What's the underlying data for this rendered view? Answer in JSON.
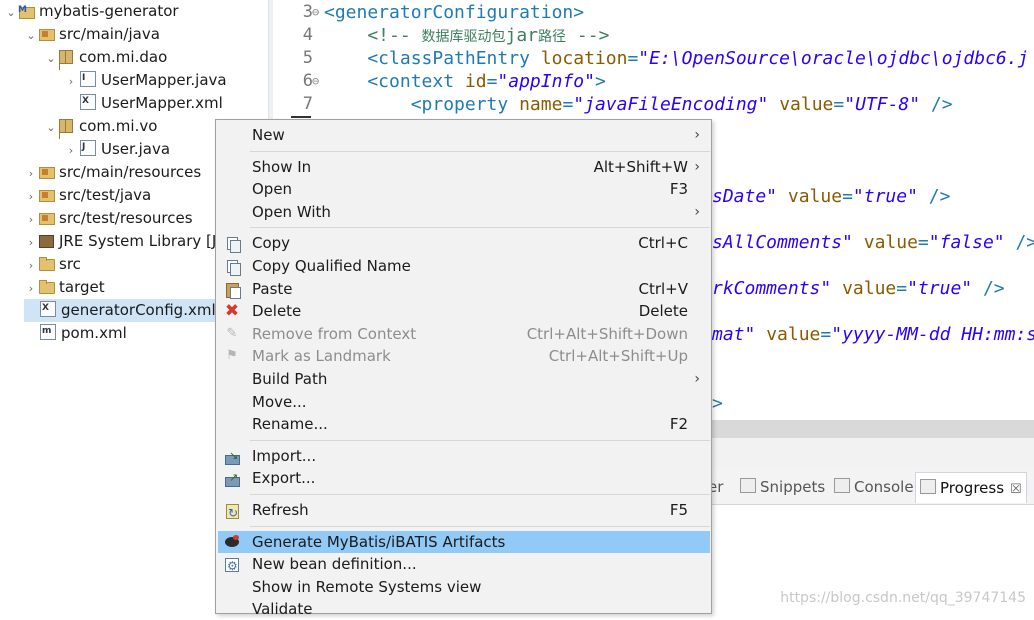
{
  "explorer": {
    "items": [
      {
        "label": "mybatis-generator",
        "twisty": "⌄",
        "icon": "project-icon"
      },
      {
        "label": "src/main/java",
        "twisty": "⌄",
        "icon": "source-folder-icon"
      },
      {
        "label": "com.mi.dao",
        "twisty": "⌄",
        "icon": "package-icon"
      },
      {
        "label": "UserMapper.java",
        "twisty": "›",
        "icon": "java-interface-icon"
      },
      {
        "label": "UserMapper.xml",
        "twisty": "",
        "icon": "xml-file-icon"
      },
      {
        "label": "com.mi.vo",
        "twisty": "⌄",
        "icon": "package-icon"
      },
      {
        "label": "User.java",
        "twisty": "›",
        "icon": "java-file-icon"
      },
      {
        "label": "src/main/resources",
        "twisty": "›",
        "icon": "source-folder-icon"
      },
      {
        "label": "src/test/java",
        "twisty": "›",
        "icon": "source-folder-icon"
      },
      {
        "label": "src/test/resources",
        "twisty": "›",
        "icon": "source-folder-icon"
      },
      {
        "label": "JRE System Library [J2",
        "twisty": "›",
        "icon": "library-icon"
      },
      {
        "label": "src",
        "twisty": "›",
        "icon": "folder-icon"
      },
      {
        "label": "target",
        "twisty": "›",
        "icon": "folder-icon"
      },
      {
        "label": "generatorConfig.xml",
        "twisty": "",
        "icon": "xml-file-icon"
      },
      {
        "label": "pom.xml",
        "twisty": "",
        "icon": "maven-pom-icon"
      }
    ]
  },
  "editor": {
    "lines": [
      {
        "num": "3",
        "fold": "⊖",
        "parts": [
          [
            "tag",
            "<generatorConfiguration>"
          ]
        ]
      },
      {
        "num": "4",
        "fold": "",
        "parts": [
          [
            "com",
            "    <!-- "
          ],
          [
            "cjkcom",
            "数据库驱动包"
          ],
          [
            "com",
            "jar"
          ],
          [
            "cjkcom",
            "路径"
          ],
          [
            "com",
            " -->"
          ]
        ]
      },
      {
        "num": "5",
        "fold": "",
        "parts": [
          [
            "tag",
            "    <classPathEntry "
          ],
          [
            "attr",
            "location"
          ],
          [
            "tag",
            "="
          ],
          [
            "val",
            "\"E:\\OpenSource\\oracle\\ojdbc\\ojdbc6.j"
          ]
        ]
      },
      {
        "num": "6",
        "fold": "⊖",
        "parts": [
          [
            "tag",
            "    <context "
          ],
          [
            "attr",
            "id"
          ],
          [
            "tag",
            "="
          ],
          [
            "val",
            "\"appInfo\""
          ],
          [
            "tag",
            ">"
          ]
        ]
      },
      {
        "num": "7",
        "fold": "",
        "parts": [
          [
            "tag",
            "        <property "
          ],
          [
            "attr",
            "name"
          ],
          [
            "tag",
            "="
          ],
          [
            "val",
            "\"javaFileEncoding\""
          ],
          [
            "tag",
            " "
          ],
          [
            "attr",
            "value"
          ],
          [
            "tag",
            "="
          ],
          [
            "val",
            "\"UTF-8\""
          ],
          [
            "tag",
            " />"
          ]
        ]
      }
    ],
    "partials": [
      [
        [
          "val",
          "sDate\""
        ],
        [
          "tag",
          " "
        ],
        [
          "attr",
          "value"
        ],
        [
          "tag",
          "="
        ],
        [
          "val",
          "\"true\""
        ],
        [
          "tag",
          " />"
        ]
      ],
      [
        [
          "val",
          "sAllComments\""
        ],
        [
          "tag",
          " "
        ],
        [
          "attr",
          "value"
        ],
        [
          "tag",
          "="
        ],
        [
          "val",
          "\"false\""
        ],
        [
          "tag",
          " />"
        ]
      ],
      [
        [
          "val",
          "rkComments\""
        ],
        [
          "tag",
          " "
        ],
        [
          "attr",
          "value"
        ],
        [
          "tag",
          "="
        ],
        [
          "val",
          "\"true\""
        ],
        [
          "tag",
          " />"
        ]
      ],
      [
        [
          "val",
          "mat\""
        ],
        [
          "tag",
          " "
        ],
        [
          "attr",
          "value"
        ],
        [
          "tag",
          "="
        ],
        [
          "val",
          "\"yyyy-MM-dd HH:mm:s"
        ]
      ],
      [
        [
          "tag",
          ">"
        ]
      ]
    ]
  },
  "views": {
    "tabs": [
      {
        "label": "er",
        "icon": ""
      },
      {
        "label": "Snippets",
        "icon": "snippets-icon"
      },
      {
        "label": "Console",
        "icon": "console-icon"
      },
      {
        "label": "Progress",
        "icon": "progress-icon",
        "close": "☒",
        "active": true
      }
    ],
    "watermark": "https://blog.csdn.net/qq_39747145"
  },
  "menu": {
    "items": [
      {
        "label": "New",
        "shortcut": "",
        "submenu": true,
        "icon": ""
      },
      {
        "sep": true
      },
      {
        "label": "Show In",
        "shortcut": "Alt+Shift+W",
        "submenu": true,
        "icon": ""
      },
      {
        "label": "Open",
        "shortcut": "F3",
        "submenu": false,
        "icon": ""
      },
      {
        "label": "Open With",
        "shortcut": "",
        "submenu": true,
        "icon": ""
      },
      {
        "sep": true
      },
      {
        "label": "Copy",
        "shortcut": "Ctrl+C",
        "submenu": false,
        "icon": "copy-icon"
      },
      {
        "label": "Copy Qualified Name",
        "shortcut": "",
        "submenu": false,
        "icon": "copy-icon"
      },
      {
        "label": "Paste",
        "shortcut": "Ctrl+V",
        "submenu": false,
        "icon": "paste-icon"
      },
      {
        "label": "Delete",
        "shortcut": "Delete",
        "submenu": false,
        "icon": "delete-icon"
      },
      {
        "label": "Remove from Context",
        "shortcut": "Ctrl+Alt+Shift+Down",
        "submenu": false,
        "icon": "remove-context-icon",
        "disabled": true
      },
      {
        "label": "Mark as Landmark",
        "shortcut": "Ctrl+Alt+Shift+Up",
        "submenu": false,
        "icon": "landmark-icon",
        "disabled": true
      },
      {
        "label": "Build Path",
        "shortcut": "",
        "submenu": true,
        "icon": ""
      },
      {
        "label": "Move...",
        "shortcut": "",
        "submenu": false,
        "icon": ""
      },
      {
        "label": "Rename...",
        "shortcut": "F2",
        "submenu": false,
        "icon": ""
      },
      {
        "sep": true
      },
      {
        "label": "Import...",
        "shortcut": "",
        "submenu": false,
        "icon": "import-icon"
      },
      {
        "label": "Export...",
        "shortcut": "",
        "submenu": false,
        "icon": "export-icon"
      },
      {
        "sep": true
      },
      {
        "label": "Refresh",
        "shortcut": "F5",
        "submenu": false,
        "icon": "refresh-icon"
      },
      {
        "sep": true
      },
      {
        "label": "Generate MyBatis/iBATIS Artifacts",
        "shortcut": "",
        "submenu": false,
        "icon": "mybatis-icon",
        "highlighted": true
      },
      {
        "label": "New bean definition...",
        "shortcut": "",
        "submenu": false,
        "icon": "bean-definition-icon"
      },
      {
        "label": "Show in Remote Systems view",
        "shortcut": "",
        "submenu": false,
        "icon": ""
      },
      {
        "label": "Validate",
        "shortcut": "",
        "submenu": false,
        "icon": ""
      }
    ],
    "submenu_arrow": "›"
  }
}
